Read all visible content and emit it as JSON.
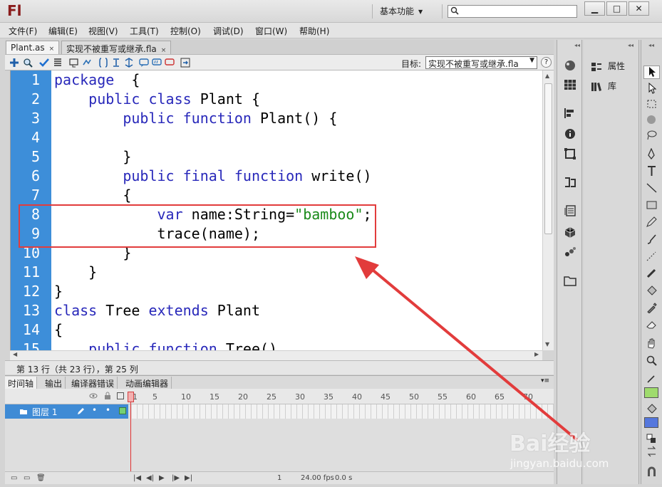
{
  "app": {
    "logo": "Fl",
    "workspace": "基本功能"
  },
  "window_buttons": [
    "▁",
    "□",
    "✕"
  ],
  "menu": [
    "文件(F)",
    "编辑(E)",
    "视图(V)",
    "工具(T)",
    "控制(O)",
    "调试(D)",
    "窗口(W)",
    "帮助(H)"
  ],
  "tabs": [
    {
      "label": "Plant.as",
      "close": "×"
    },
    {
      "label": "实现不被重写或继承.fla",
      "close": "×"
    }
  ],
  "toolbar": {
    "target_label": "目标:",
    "target_value": "实现不被重写或继承.fla",
    "help": "?"
  },
  "code_lines": [
    {
      "n": "1",
      "segs": [
        {
          "t": "package",
          "c": "kw"
        },
        {
          "t": "  {",
          "c": ""
        }
      ]
    },
    {
      "n": "2",
      "segs": [
        {
          "t": "    public class",
          "c": "kw"
        },
        {
          "t": " Plant {",
          "c": ""
        }
      ]
    },
    {
      "n": "3",
      "segs": [
        {
          "t": "        public function",
          "c": "kw"
        },
        {
          "t": " Plant() {",
          "c": ""
        }
      ]
    },
    {
      "n": "4",
      "segs": []
    },
    {
      "n": "5",
      "segs": [
        {
          "t": "        }",
          "c": ""
        }
      ]
    },
    {
      "n": "6",
      "segs": [
        {
          "t": "        public final function",
          "c": "kw"
        },
        {
          "t": " write()",
          "c": ""
        }
      ]
    },
    {
      "n": "7",
      "segs": [
        {
          "t": "        {",
          "c": ""
        }
      ]
    },
    {
      "n": "8",
      "segs": [
        {
          "t": "            var",
          "c": "kw"
        },
        {
          "t": " name:String=",
          "c": ""
        },
        {
          "t": "\"bamboo\"",
          "c": "str"
        },
        {
          "t": ";",
          "c": ""
        }
      ]
    },
    {
      "n": "9",
      "segs": [
        {
          "t": "            trace(name);",
          "c": ""
        }
      ]
    },
    {
      "n": "10",
      "segs": [
        {
          "t": "        }",
          "c": ""
        }
      ]
    },
    {
      "n": "11",
      "segs": [
        {
          "t": "    }",
          "c": ""
        }
      ]
    },
    {
      "n": "12",
      "segs": [
        {
          "t": "}",
          "c": ""
        }
      ]
    },
    {
      "n": "13",
      "segs": [
        {
          "t": "class",
          "c": "kw"
        },
        {
          "t": " Tree ",
          "c": ""
        },
        {
          "t": "extends",
          "c": "kw"
        },
        {
          "t": " Plant",
          "c": ""
        }
      ]
    },
    {
      "n": "14",
      "segs": [
        {
          "t": "{",
          "c": ""
        }
      ]
    },
    {
      "n": "15",
      "segs": [
        {
          "t": "    public function",
          "c": "kw"
        },
        {
          "t": " Tree()",
          "c": ""
        }
      ]
    }
  ],
  "status": "第 13 行（共 23 行），第 25 列",
  "timeline": {
    "tabs": [
      "时间轴",
      "输出",
      "编译器错误",
      "动画编辑器"
    ],
    "ruler": [
      "1",
      "5",
      "10",
      "15",
      "20",
      "25",
      "30",
      "35",
      "40",
      "45",
      "50",
      "55",
      "60",
      "65",
      "70"
    ],
    "layer_name": "图层 1",
    "footer": {
      "frame": "1",
      "fps": "24.00 fps",
      "time": "0.0 s"
    }
  },
  "right_panel": {
    "items": [
      "属性",
      "库"
    ]
  },
  "watermark": {
    "brand": "Bai经验",
    "url": "jingyan.baidu.com"
  },
  "colors": {
    "gutter": "#3d8ed9",
    "keyword": "#2828ba",
    "string": "#1a8a1a",
    "highlight": "#e23c3c"
  }
}
